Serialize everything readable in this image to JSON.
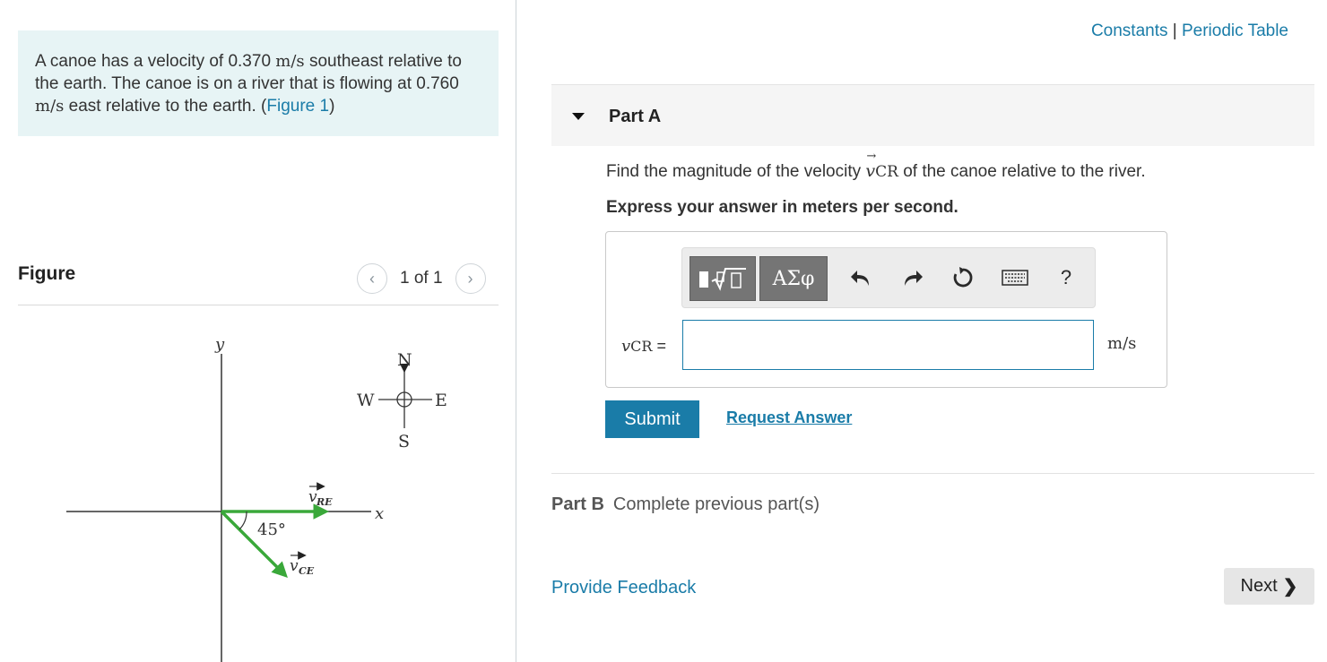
{
  "problem": {
    "text_1": "A canoe has a velocity of 0.370 ",
    "unit_1": "m/s",
    "text_2": " southeast relative to the earth. The canoe is on a river that is flowing at 0.760 ",
    "unit_2": "m/s",
    "text_3": " east relative to the earth. (",
    "figure_link": "Figure 1",
    "text_4": ")"
  },
  "figure": {
    "title": "Figure",
    "pager_text": "1 of 1",
    "prev_icon": "chevron-left-icon",
    "next_icon": "chevron-right-icon",
    "axis_y": "y",
    "axis_x": "x",
    "compass_n": "N",
    "compass_s": "S",
    "compass_e": "E",
    "compass_w": "W",
    "vec_re_main": "v",
    "vec_re_sub": "RE",
    "vec_ce_main": "v",
    "vec_ce_sub": "CE",
    "angle": "45°",
    "arrow_color": "#3aa83a"
  },
  "header_links": {
    "constants": "Constants",
    "separator": " | ",
    "periodic_table": "Periodic Table"
  },
  "part_a": {
    "title": "Part A",
    "question_1": "Find the magnitude of the velocity ",
    "vector": "v",
    "vector_sub": "CR",
    "question_2": " of the canoe relative to the river.",
    "instruction": "Express your answer in meters per second.",
    "answer_label_main": "v",
    "answer_label_sub": "CR",
    "answer_label_eq": " =",
    "answer_value": "",
    "unit": "m/s",
    "submit": "Submit",
    "request_answer": "Request Answer"
  },
  "toolbar": {
    "templates_icon": "templates-sqrt-icon",
    "greek_label": "ΑΣφ",
    "undo_icon": "undo-icon",
    "redo_icon": "redo-icon",
    "reset_icon": "reset-icon",
    "keyboard_icon": "keyboard-icon",
    "help_label": "?"
  },
  "part_b": {
    "label": "Part B",
    "status": "Complete previous part(s)"
  },
  "footer": {
    "feedback": "Provide Feedback",
    "next": "Next"
  },
  "colors": {
    "accent": "#1a7ca8",
    "problem_bg": "#e7f4f5",
    "toolbar_btn": "#757575"
  }
}
